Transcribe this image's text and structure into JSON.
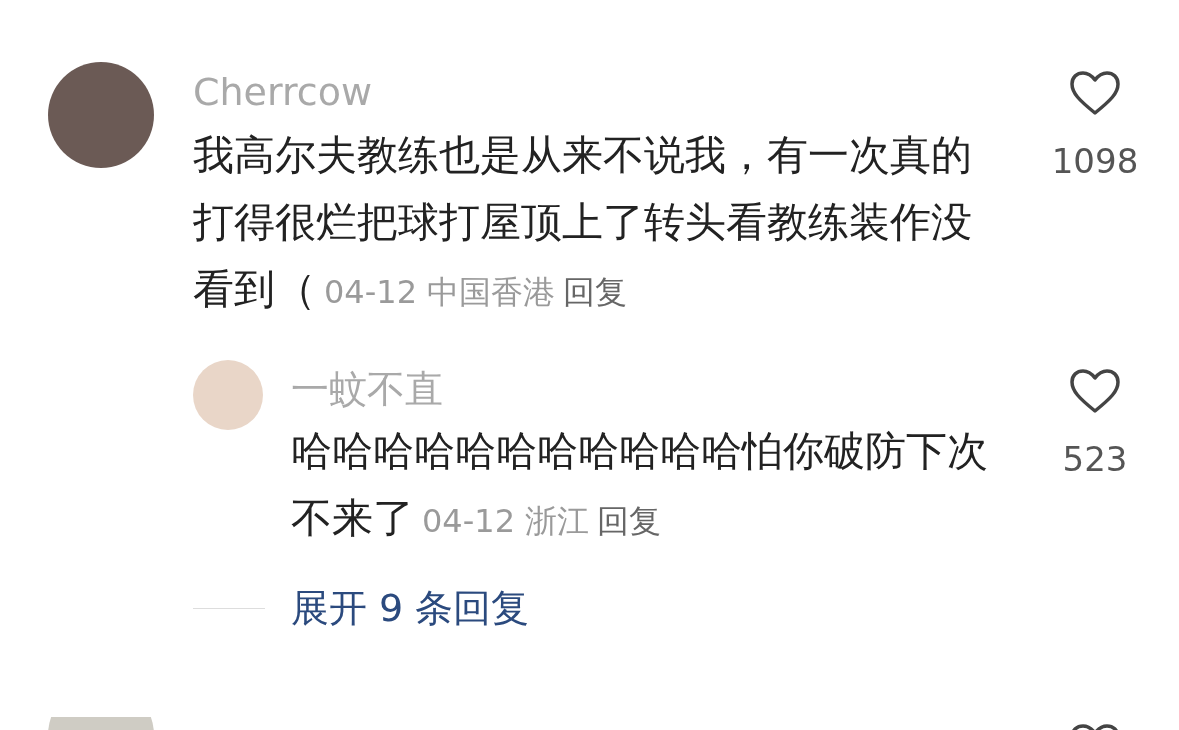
{
  "comments": [
    {
      "username": "Cherrcow",
      "text": "我高尔夫教练也是从来不说我，有一次真的打得很烂把球打屋顶上了转头看教练装作没看到（",
      "date": "04-12",
      "location": "中国香港",
      "reply_label": "回复",
      "likes": "1098",
      "replies": [
        {
          "username": "一蚊不直",
          "text": "哈哈哈哈哈哈哈哈哈哈哈怕你破防下次不来了",
          "date": "04-12",
          "location": "浙江",
          "reply_label": "回复",
          "likes": "523"
        }
      ],
      "expand_label": "展开 9 条回复"
    }
  ],
  "more_comment_below": true
}
